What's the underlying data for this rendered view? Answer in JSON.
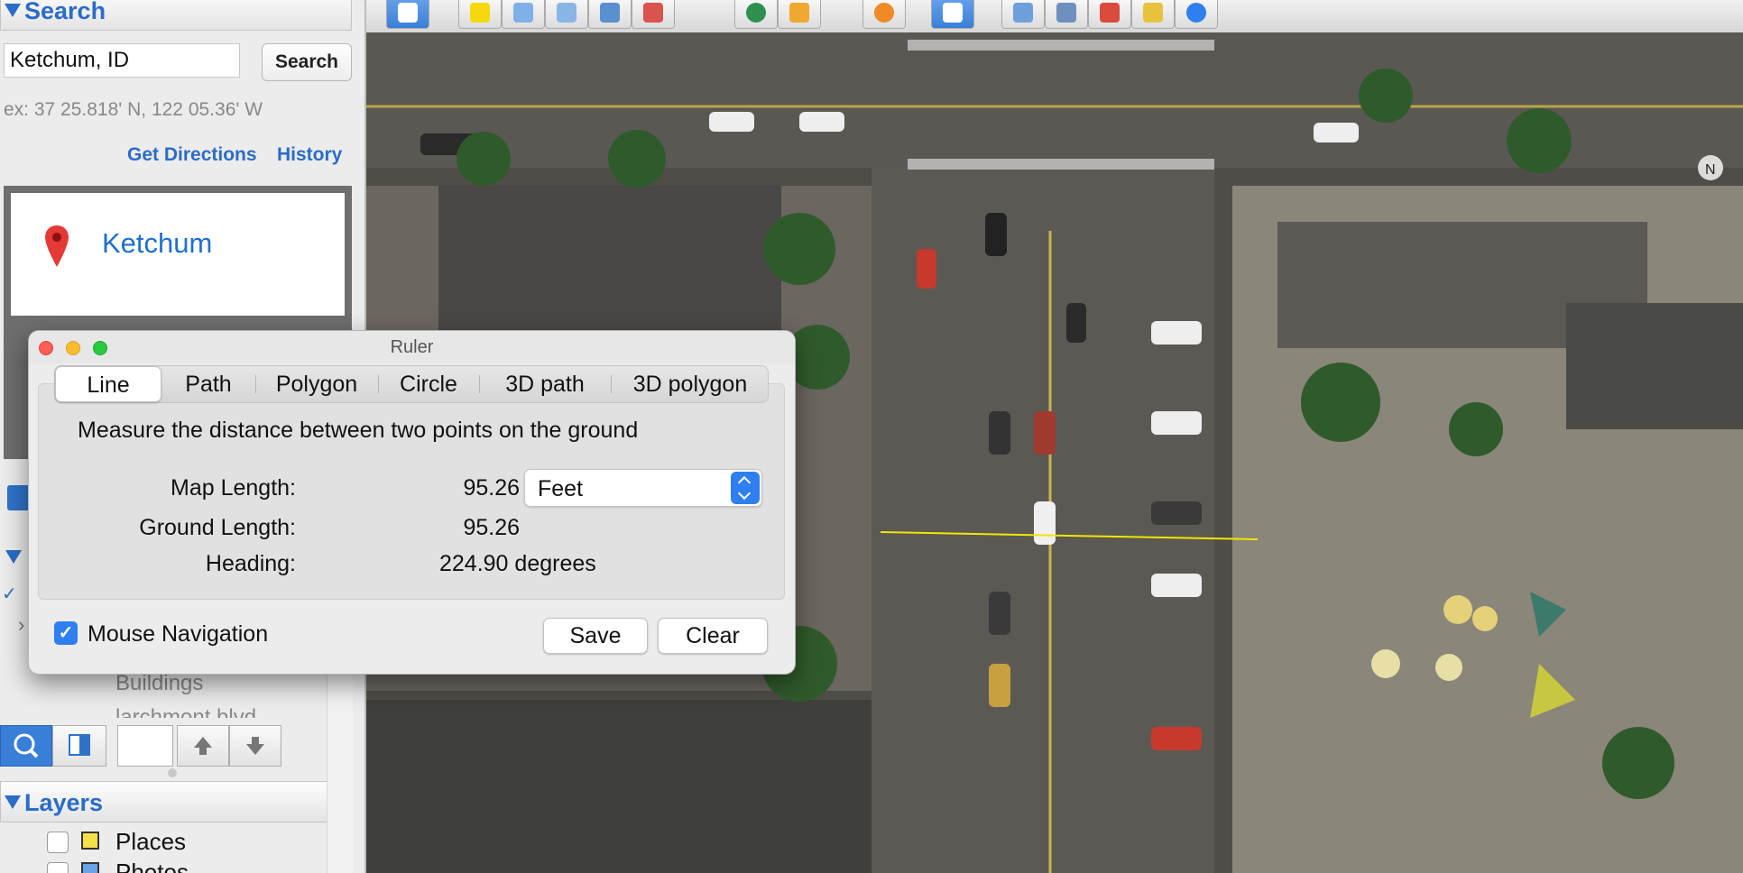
{
  "sidebar": {
    "search_header": "Search",
    "search_value": "Ketchum, ID",
    "search_button": "Search",
    "search_hint": "ex: 37 25.818' N, 122 05.36' W",
    "get_directions": "Get Directions",
    "history": "History",
    "result_title": "Ketchum",
    "buildings_label": "Buildings",
    "larchmont_label": "larchmont blvd",
    "layers_header": "Layers",
    "layers": [
      {
        "label": "Places"
      },
      {
        "label": "Photos"
      }
    ]
  },
  "ruler": {
    "title": "Ruler",
    "tabs": [
      "Line",
      "Path",
      "Polygon",
      "Circle",
      "3D path",
      "3D polygon"
    ],
    "active_tab": "Line",
    "description": "Measure the distance between two points on the ground",
    "map_length_label": "Map Length:",
    "map_length_value": "95.26",
    "ground_length_label": "Ground Length:",
    "ground_length_value": "95.26",
    "heading_label": "Heading:",
    "heading_value": "224.90 degrees",
    "unit": "Feet",
    "mouse_navigation_label": "Mouse Navigation",
    "mouse_navigation_checked": true,
    "save_label": "Save",
    "clear_label": "Clear"
  },
  "colors": {
    "accent": "#2b6cc7",
    "ruler_line": "#f2e600",
    "pin": "#e53935"
  }
}
